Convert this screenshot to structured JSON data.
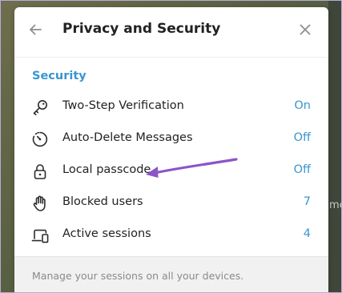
{
  "window": {
    "title": "Privacy and Security",
    "background_hint_text": "me"
  },
  "colors": {
    "accent": "#3a95d1",
    "annotation_arrow": "#8b55c9",
    "text_primary": "#222222",
    "text_secondary": "#8a8a8a"
  },
  "security": {
    "section_title": "Security",
    "items": [
      {
        "label": "Two-Step Verification",
        "value": "On",
        "icon": "key-icon"
      },
      {
        "label": "Auto-Delete Messages",
        "value": "Off",
        "icon": "timer-icon"
      },
      {
        "label": "Local passcode",
        "value": "Off",
        "icon": "lock-icon"
      },
      {
        "label": "Blocked users",
        "value": "7",
        "icon": "hand-icon"
      },
      {
        "label": "Active sessions",
        "value": "4",
        "icon": "devices-icon"
      }
    ],
    "footer_hint": "Manage your sessions on all your devices."
  }
}
